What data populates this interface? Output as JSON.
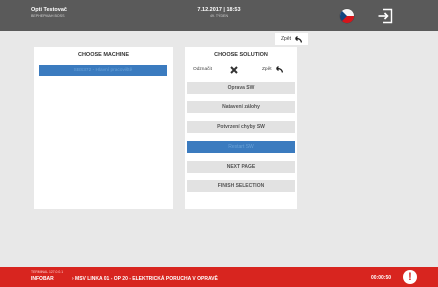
{
  "header": {
    "user_name": "Opti Testovač",
    "user_role": "ВЕРНЕРМАН BOSS",
    "datetime": "7.12.2017 | 18:53",
    "week": "49. TÝDEN",
    "language_flag": "flag-czech",
    "logout_icon": "logout-icon"
  },
  "back_button": {
    "label": "Zpět"
  },
  "machine_panel": {
    "title": "CHOOSE MACHINE",
    "items": [
      "SBS372 - Hlavní pracoviště"
    ]
  },
  "solution_panel": {
    "title": "CHOOSE SOLUTION",
    "deselect_label": "Odznačit",
    "back_label": "Zpět",
    "options": [
      {
        "label": "Oprava SW",
        "selected": false
      },
      {
        "label": "Natavení zálohy",
        "selected": false
      },
      {
        "label": "Potvrzení chyby SW",
        "selected": false
      },
      {
        "label": "Restart SW",
        "selected": true
      },
      {
        "label": "NEXT PAGE",
        "selected": false
      },
      {
        "label": "FINISH SELECTION",
        "selected": false
      }
    ]
  },
  "footer": {
    "terminal": "TERMINAL 127.0.0.1",
    "infobar_label": "INFOBAR",
    "message": "› MSV LINKA 01 - OP 20 - ELEKTRICKÁ PORUCHA V OPRAVĚ",
    "timer": "00:00:50",
    "alert_symbol": "!"
  },
  "colors": {
    "header_bg": "#5a5a5a",
    "footer_bg": "#d8251f",
    "selected_bg": "#3b7bbf",
    "option_bg": "#e2e2e2"
  }
}
